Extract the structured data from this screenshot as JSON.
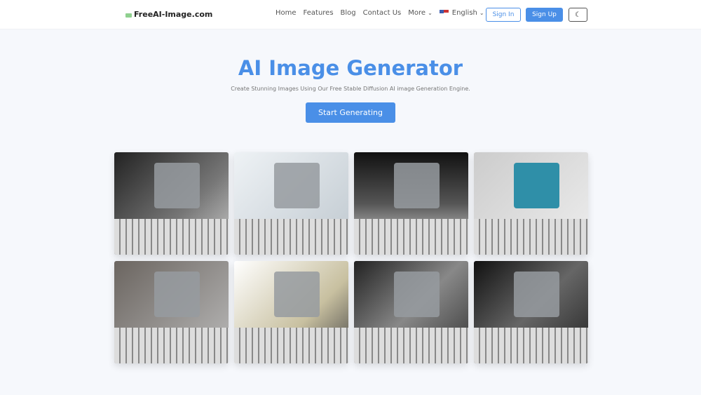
{
  "header": {
    "logo": "FreeAI-Image.com",
    "nav": [
      "Home",
      "Features",
      "Blog",
      "Contact Us"
    ],
    "more": "More",
    "language": "English",
    "sign_in": "Sign In",
    "sign_up": "Sign Up",
    "theme_icon": "moon-icon"
  },
  "hero": {
    "title": "AI Image Generator",
    "subtitle": "Create Stunning Images Using Our Free Stable Diffusion AI image Generation Engine.",
    "cta": "Start Generating"
  },
  "colors": {
    "accent": "#4a8fe7"
  },
  "gallery": [
    {
      "alt": "Robot typing on keyboard 1",
      "bg": "linear-gradient(135deg,#222,#777 60%,#ccc)"
    },
    {
      "alt": "Robot typing on keyboard 2",
      "bg": "linear-gradient(135deg,#eef2f5,#bfc8cf)"
    },
    {
      "alt": "Robot typing on keyboard 3",
      "bg": "linear-gradient(180deg,#111,#555 50%,#eee)"
    },
    {
      "alt": "Robot typing on keyboard 4",
      "bg": "linear-gradient(135deg,#ccc,#eee)",
      "robot": "#2f8fa8"
    },
    {
      "alt": "Robot typing on keyboard 5",
      "bg": "linear-gradient(135deg,#6b6560,#bbb)"
    },
    {
      "alt": "Robot typing on keyboard 6",
      "bg": "linear-gradient(135deg,#fff,#c8c0a0 60%,#444)"
    },
    {
      "alt": "Robot typing on keyboard 7",
      "bg": "linear-gradient(135deg,#222,#888,#333)"
    },
    {
      "alt": "Robot typing on keyboard 8",
      "bg": "linear-gradient(135deg,#111,#666 50%,#222)"
    }
  ]
}
